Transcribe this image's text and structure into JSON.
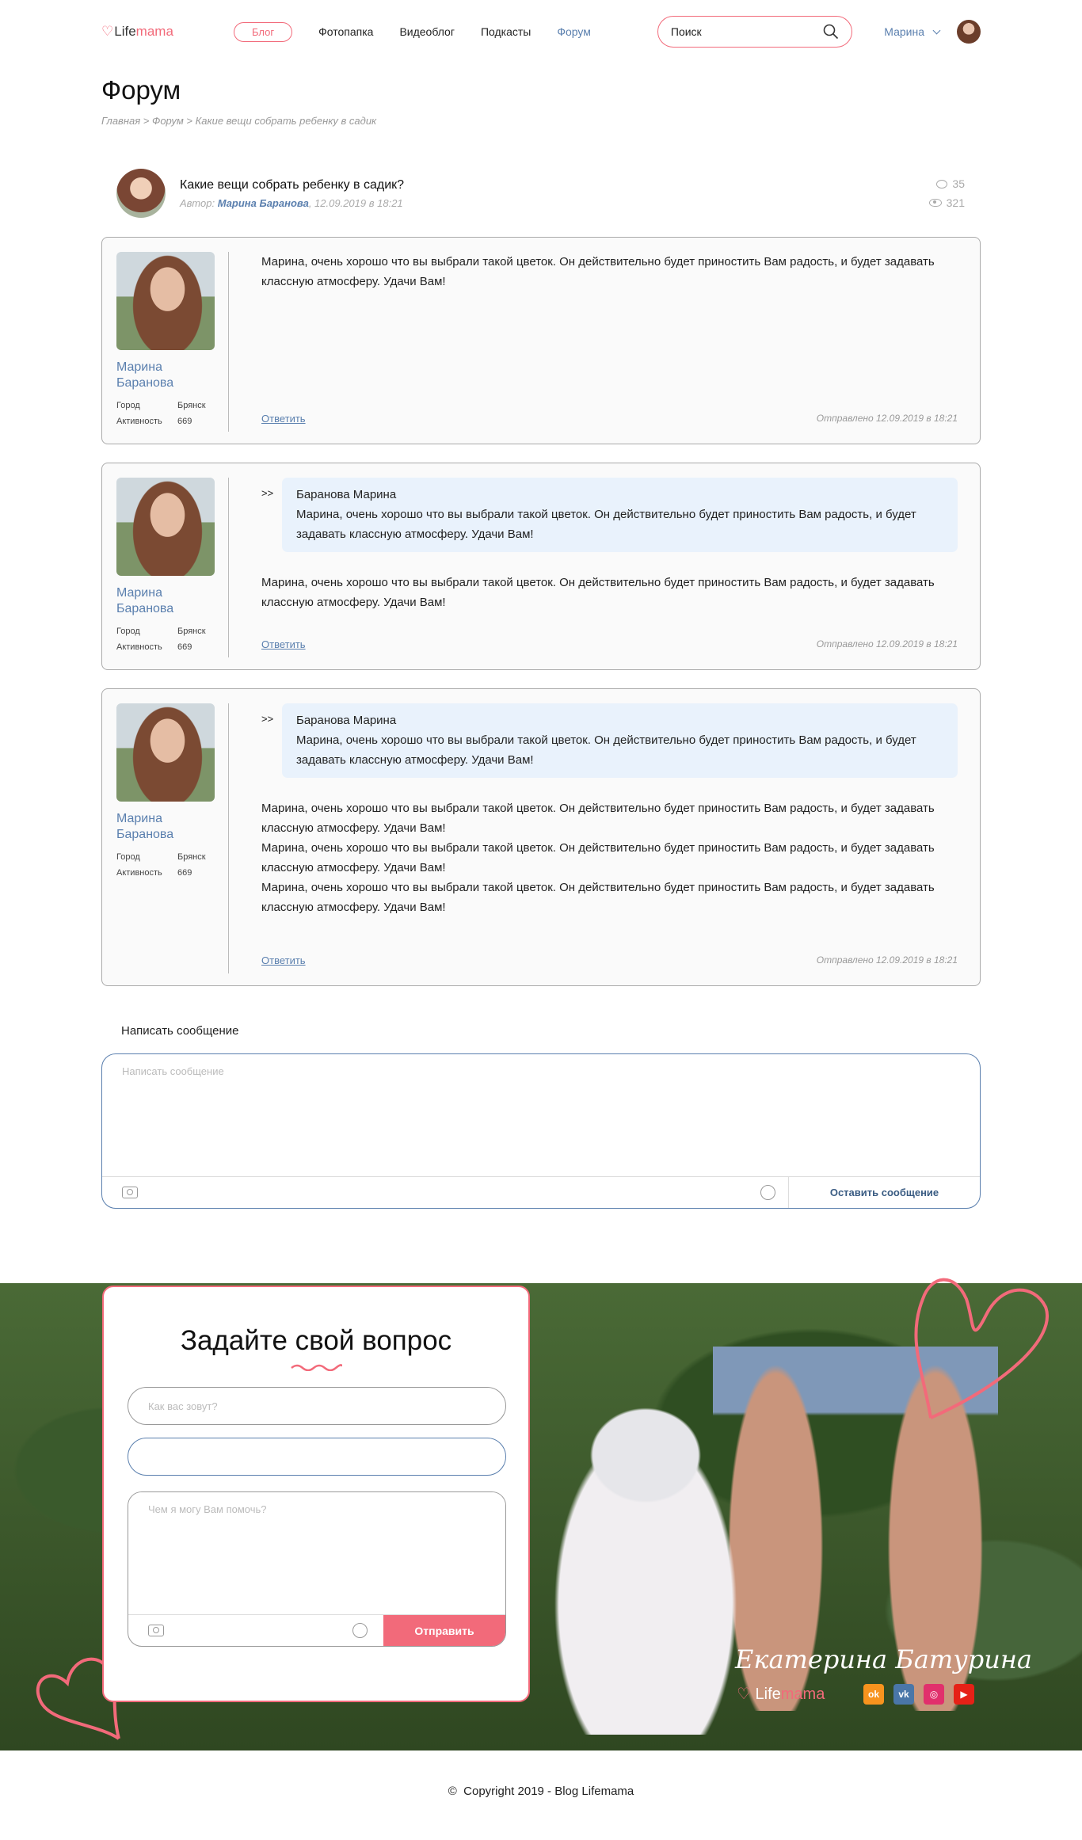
{
  "header": {
    "logo_life": "Life",
    "logo_mama": "mama",
    "nav": [
      "Блог",
      "Фотопапка",
      "Видеоблог",
      "Подкасты",
      "Форум"
    ],
    "search_placeholder": "Поиск",
    "user_name": "Марина"
  },
  "page": {
    "title": "Форум",
    "breadcrumb": "Главная > Форум > Какие вещи собрать ребенку в садик"
  },
  "topic": {
    "title": "Какие вещи собрать ребенку в садик?",
    "author_label": "Автор:",
    "author": "Марина Баранова",
    "date": "12.09.2019 в 18:21",
    "comments": "35",
    "views": "321"
  },
  "posts": [
    {
      "author": "Марина Баранова",
      "city_label": "Город",
      "city": "Брянск",
      "activity_label": "Активность",
      "activity": "669",
      "text": "Марина, очень хорошо что вы выбрали такой цветок. Он действительно будет приностить Вам радость, и будет задавать классную атмосферу. Удачи Вам!",
      "reply": "Ответить",
      "sent": "Отправлено 12.09.2019 в 18:21"
    },
    {
      "author": "Марина Баранова",
      "city_label": "Город",
      "city": "Брянск",
      "activity_label": "Активность",
      "activity": "669",
      "quote_mark": ">>",
      "quote_author": "Баранова Марина",
      "quote_text": "Марина, очень хорошо что вы выбрали такой цветок. Он действительно будет приностить Вам радость, и будет задавать классную атмосферу. Удачи Вам!",
      "text": "Марина, очень хорошо что вы выбрали такой цветок. Он действительно будет приностить Вам радость, и будет задавать классную атмосферу. Удачи Вам!",
      "reply": "Ответить",
      "sent": "Отправлено 12.09.2019 в 18:21"
    },
    {
      "author": "Марина Баранова",
      "city_label": "Город",
      "city": "Брянск",
      "activity_label": "Активность",
      "activity": "669",
      "quote_mark": ">>",
      "quote_author": "Баранова Марина",
      "quote_text": "Марина, очень хорошо что вы выбрали такой цветок. Он действительно будет приностить Вам радость, и будет задавать классную атмосферу. Удачи Вам!",
      "text_lines": [
        "Марина, очень хорошо что вы выбрали такой цветок. Он действительно будет приностить Вам радость, и будет задавать классную атмосферу. Удачи Вам!",
        "Марина, очень хорошо что вы выбрали такой цветок. Он действительно будет приностить Вам радость, и будет задавать классную атмосферу. Удачи Вам!",
        "Марина, очень хорошо что вы выбрали такой цветок. Он действительно будет приностить Вам радость, и будет задавать классную атмосферу. Удачи Вам!"
      ],
      "reply": "Ответить",
      "sent": "Отправлено 12.09.2019 в 18:21"
    }
  ],
  "composer": {
    "label": "Написать сообщение",
    "placeholder": "Написать сообщение",
    "send": "Оставить сообщение"
  },
  "question_form": {
    "title": "Задайте свой вопрос",
    "name_placeholder": "Как вас зовут?",
    "message_placeholder": "Чем я могу Вам помочь?",
    "send": "Отправить"
  },
  "footer": {
    "signature": "Екатерина Батурина",
    "logo_life": "Life",
    "logo_mama": "mama",
    "copyright": "Copyright 2019 - Blog Lifemama"
  },
  "colors": {
    "accent_pink": "#f26a7a",
    "accent_blue": "#5a7fae",
    "quote_bg": "#e9f2fc"
  }
}
